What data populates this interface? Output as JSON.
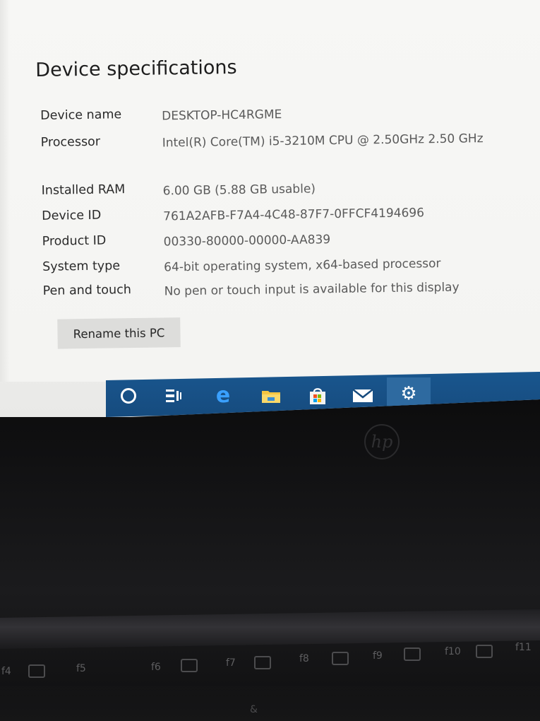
{
  "specs": {
    "heading": "Device specifications",
    "rows": [
      {
        "label": "Device name",
        "value": "DESKTOP-HC4RGME"
      },
      {
        "label": "Processor",
        "value": "Intel(R) Core(TM) i5-3210M CPU @ 2.50GHz   2.50 GHz"
      },
      {
        "label": "Installed RAM",
        "value": "6.00 GB (5.88 GB usable)"
      },
      {
        "label": "Device ID",
        "value": "761A2AFB-F7A4-4C48-87F7-0FFCF4194696"
      },
      {
        "label": "Product ID",
        "value": "00330-80000-00000-AA839"
      },
      {
        "label": "System type",
        "value": "64-bit operating system, x64-based processor"
      },
      {
        "label": "Pen and touch",
        "value": "No pen or touch input is available for this display"
      }
    ],
    "rename_button": "Rename this PC"
  },
  "taskbar": {
    "items": [
      {
        "icon": "cortana-icon"
      },
      {
        "icon": "task-view-icon"
      },
      {
        "icon": "edge-icon"
      },
      {
        "icon": "file-explorer-icon"
      },
      {
        "icon": "store-icon"
      },
      {
        "icon": "mail-icon"
      },
      {
        "icon": "settings-gear-icon",
        "active": true
      }
    ],
    "accent": "#19568e",
    "edge_glyph": "e",
    "gear_glyph": "⚙"
  },
  "laptop": {
    "logo": "hp",
    "function_keys": [
      "f4",
      "f5",
      "f6",
      "f7",
      "f8",
      "f9",
      "f10",
      "f11"
    ],
    "lower_key": "&"
  }
}
